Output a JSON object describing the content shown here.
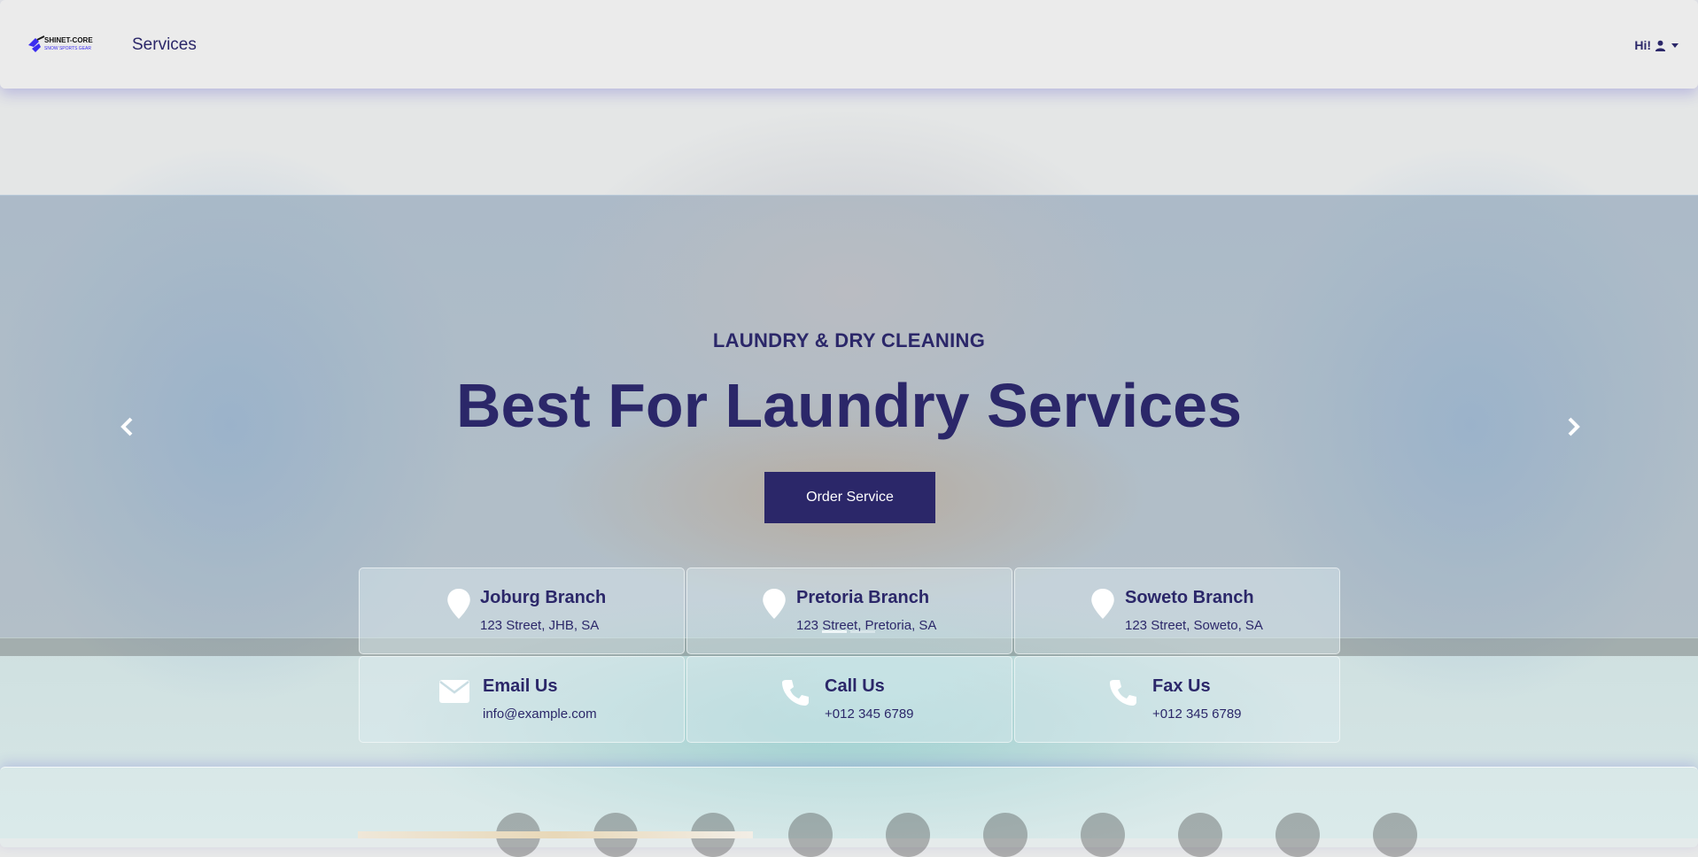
{
  "navbar": {
    "logo_alt": "SHINET-CORE",
    "logo_sub": "SNOW SPORTS GEAR",
    "link_services": "Services",
    "user_greeting": "Hi!"
  },
  "hero": {
    "subtitle": "LAUNDRY & DRY CLEANING",
    "title": "Best For Laundry Services",
    "cta_label": "Order Service"
  },
  "branches": [
    {
      "title": "Joburg Branch",
      "address": "123 Street, JHB, SA"
    },
    {
      "title": "Pretoria Branch",
      "address": "123 Street, Pretoria, SA"
    },
    {
      "title": "Soweto Branch",
      "address": "123 Street, Soweto, SA"
    }
  ],
  "contacts": [
    {
      "title": "Email Us",
      "value": "info@example.com"
    },
    {
      "title": "Call Us",
      "value": "+012 345 6789"
    },
    {
      "title": "Fax Us",
      "value": "+012 345 6789"
    }
  ],
  "icons": {
    "branch": "map-marker-icon",
    "email": "envelope-icon",
    "call": "phone-icon",
    "fax": "phone-icon",
    "user": "user-icon",
    "prev": "chevron-left-icon",
    "next": "chevron-right-icon"
  },
  "colors": {
    "brand": "#2b2769",
    "accent_blue": "#3b2cf0"
  }
}
